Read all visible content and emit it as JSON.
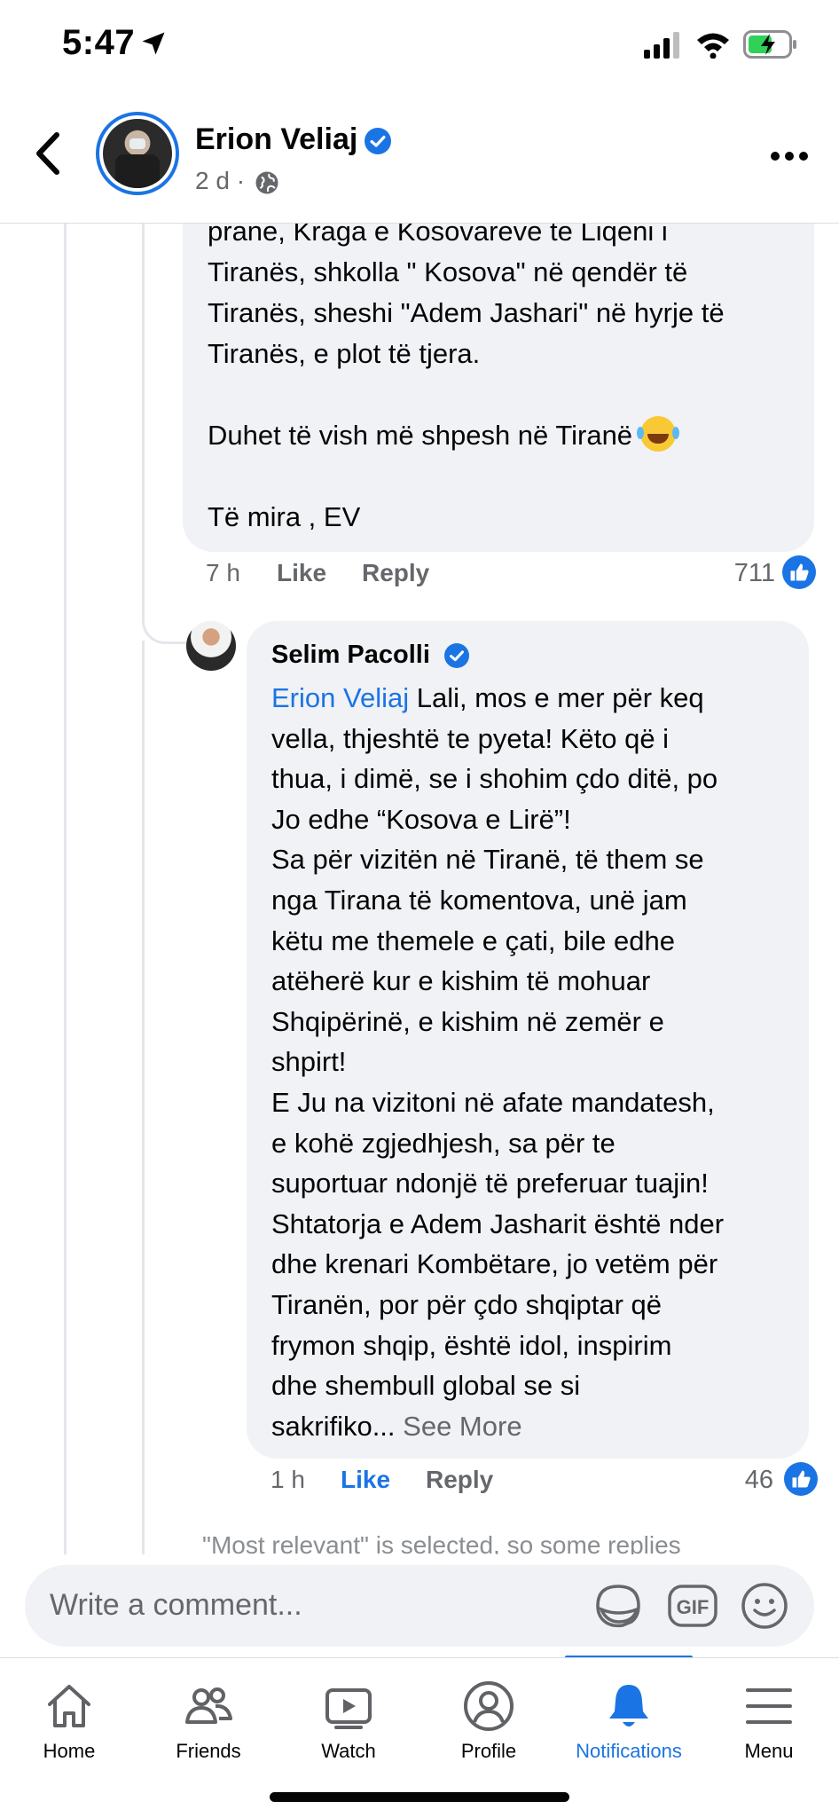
{
  "status": {
    "time": "5:47"
  },
  "header": {
    "name": "Erion Veliaj",
    "meta": "2 d ·"
  },
  "comment1": {
    "text": "prane, Kraga e Kosovareve te Liqeni i\nTiranës, shkolla \" Kosova\" në qendër të\nTiranës, sheshi \"Adem Jashari\" në hyrje të\nTiranës, e plot të tjera.\n\nDuhet të vish më shpesh në Tiranë ",
    "signoff": "Të mira , EV",
    "time": "7 h",
    "like": "Like",
    "reply": "Reply",
    "count": "711"
  },
  "comment2": {
    "name": "Selim Pacolli",
    "mention": "Erion Veliaj",
    "text": " Lali, mos e mer për keq\nvella, thjeshtë te pyeta! Këto që i\nthua, i dimë, se i shohim çdo ditë, po\nJo edhe “Kosova e Lirë”!\nSa për vizitën në Tiranë, të them se\nnga Tirana të komentova, unë jam\nkëtu me themele e çati, bile edhe\natëherë kur e kishim të mohuar\nShqipërinë, e kishim në zemër e\nshpirt!\nE Ju na vizitoni në afate mandatesh,\ne kohë zgjedhjesh, sa për te\nsuportuar ndonjë të preferuar tuajin!\nShtatorja e Adem Jasharit është nder\ndhe krenari Kombëtare, jo vetëm për\nTiranën, por për çdo shqiptar që\nfrymon shqip, është idol, inspirim\ndhe shembull global se si\nsakrifiko... ",
    "see_more": "See More",
    "time": "1 h",
    "like": "Like",
    "reply": "Reply",
    "count": "46"
  },
  "filter_note": "\"Most relevant\" is selected, so some replies",
  "composer": {
    "placeholder": "Write a comment..."
  },
  "tabs": [
    {
      "label": "Home",
      "icon": "home-icon"
    },
    {
      "label": "Friends",
      "icon": "friends-icon"
    },
    {
      "label": "Watch",
      "icon": "watch-icon"
    },
    {
      "label": "Profile",
      "icon": "profile-icon"
    },
    {
      "label": "Notifications",
      "icon": "bell-icon",
      "active": true
    },
    {
      "label": "Menu",
      "icon": "menu-icon"
    }
  ],
  "colors": {
    "accent": "#1b74e4",
    "bubble": "#f0f2f5",
    "muted": "#65676b"
  }
}
